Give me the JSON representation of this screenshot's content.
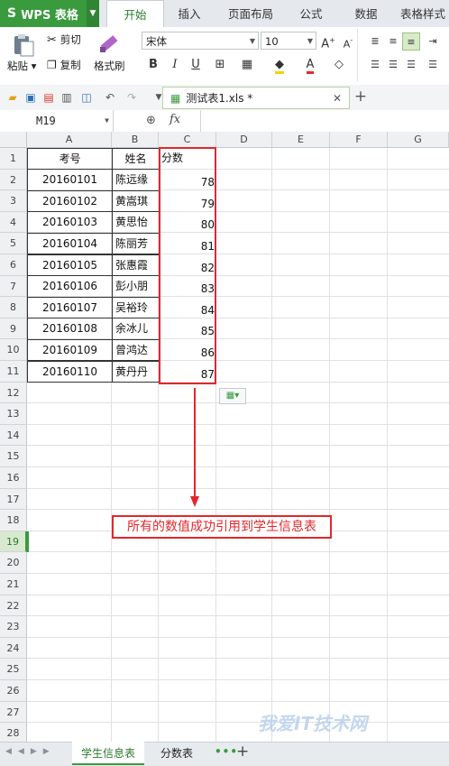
{
  "app": {
    "name": "WPS 表格",
    "logo": "S"
  },
  "menu_tabs": [
    "开始",
    "插入",
    "页面布局",
    "公式",
    "数据",
    "表格样式"
  ],
  "ribbon": {
    "paste": "粘贴",
    "cut": "剪切",
    "copy": "复制",
    "format_painter": "格式刷",
    "font_name": "宋体",
    "font_size": "10"
  },
  "document_tab": {
    "name": "测试表1.xls *"
  },
  "formula_bar": {
    "name_box": "M19",
    "fx": "fx"
  },
  "columns": [
    "A",
    "B",
    "C",
    "D",
    "E",
    "F",
    "G"
  ],
  "rows": [
    "1",
    "2",
    "3",
    "4",
    "5",
    "6",
    "7",
    "8",
    "9",
    "10",
    "11",
    "12",
    "13",
    "14",
    "15",
    "16",
    "17",
    "18",
    "19",
    "20",
    "21",
    "22",
    "23",
    "24",
    "25",
    "26",
    "27",
    "28"
  ],
  "active_row": "19",
  "table": {
    "headers": [
      "考号",
      "姓名",
      "分数"
    ],
    "data": [
      [
        "20160101",
        "陈远缘",
        "78"
      ],
      [
        "20160102",
        "黄嵩琪",
        "79"
      ],
      [
        "20160103",
        "黄思怡",
        "80"
      ],
      [
        "20160104",
        "陈丽芳",
        "81"
      ],
      [
        "20160105",
        "张惠霞",
        "82"
      ],
      [
        "20160106",
        "彭小朋",
        "83"
      ],
      [
        "20160107",
        "吴裕玲",
        "84"
      ],
      [
        "20160108",
        "余冰儿",
        "85"
      ],
      [
        "20160109",
        "曾鸿达",
        "86"
      ],
      [
        "20160110",
        "黄丹丹",
        "87"
      ]
    ]
  },
  "annotation": "所有的数值成功引用到学生信息表",
  "sheets": [
    "学生信息表",
    "分数表"
  ],
  "watermark": "我爱IT技术网",
  "colors": {
    "accent": "#3a9a3e",
    "highlight": "#e0282c"
  }
}
